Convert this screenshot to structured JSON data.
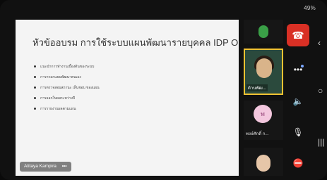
{
  "status": {
    "battery": "49%"
  },
  "slide": {
    "title": "หัวข้ออบรม การใช้ระบบแผนพัฒนารายบุคคล IDP Online",
    "items": [
      "แนะนำการทำงานเบื้องต้นของระบบ",
      "การกรอกแผนพัฒนาตนเอง",
      "การตรวจสอบสถานะ เห็นชอบ ของแผน",
      "การออกใบผลระหว่างปี",
      "การรายงานผลตามแผน"
    ]
  },
  "presenter": {
    "name": "Atitaya Kampira",
    "more": "•••"
  },
  "participants": [
    {
      "label": "ด้านพัฒ..."
    },
    {
      "initial": "พ",
      "label": "พงษ์ศักดิ์ ก..."
    }
  ],
  "icons": {
    "end_call": "phone-hangup-icon",
    "more": "more-options-icon",
    "speaker": "speaker-icon",
    "mic": "mic-off-icon",
    "camera": "camera-off-icon"
  }
}
